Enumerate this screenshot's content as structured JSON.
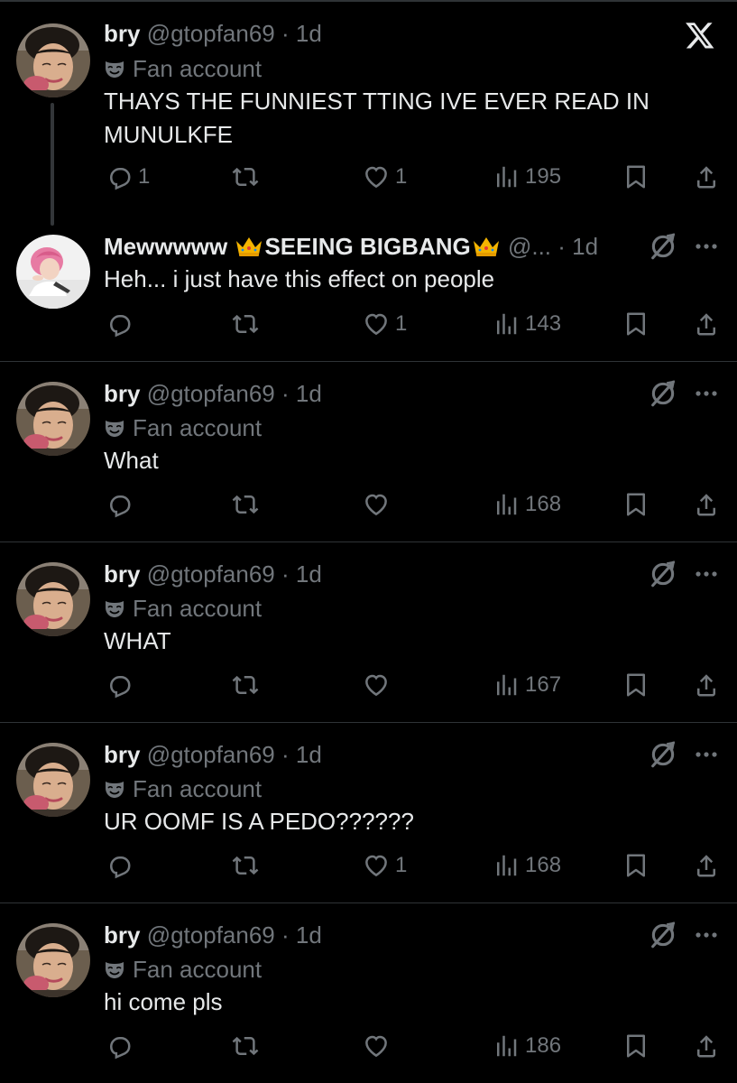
{
  "header_logo": "x-logo-icon",
  "tweets": [
    {
      "name": "bry",
      "handle": "@gtopfan69",
      "sep": " · ",
      "time": "1d",
      "label": "Fan account",
      "text": "THAYS THE FUNNIEST TTING IVE EVER READ IN MUNULKFE",
      "replies": "1",
      "likes": "1",
      "views": "195"
    },
    {
      "name_part1": "Mewwwww ",
      "name_part2": "SEEING BIGBANG",
      "handle": "@...",
      "sep": " · ",
      "time": "1d",
      "text": "Heh... i just have this effect on people",
      "replies": "",
      "likes": "1",
      "views": "143"
    },
    {
      "name": "bry",
      "handle": "@gtopfan69",
      "sep": " · ",
      "time": "1d",
      "label": "Fan account",
      "text": "What",
      "replies": "",
      "likes": "",
      "views": "168"
    },
    {
      "name": "bry",
      "handle": "@gtopfan69",
      "sep": " · ",
      "time": "1d",
      "label": "Fan account",
      "text": "WHAT",
      "replies": "",
      "likes": "",
      "views": "167"
    },
    {
      "name": "bry",
      "handle": "@gtopfan69",
      "sep": " · ",
      "time": "1d",
      "label": "Fan account",
      "text": "UR OOMF IS A PEDO??????",
      "replies": "",
      "likes": "1",
      "views": "168"
    },
    {
      "name": "bry",
      "handle": "@gtopfan69",
      "sep": " · ",
      "time": "1d",
      "label": "Fan account",
      "text": "hi come pls",
      "replies": "",
      "likes": "",
      "views": "186"
    }
  ],
  "colors": {
    "background": "#000000",
    "text": "#e7e9ea",
    "muted": "#71767b",
    "divider": "#2f3336",
    "crown": "#f4b400"
  }
}
